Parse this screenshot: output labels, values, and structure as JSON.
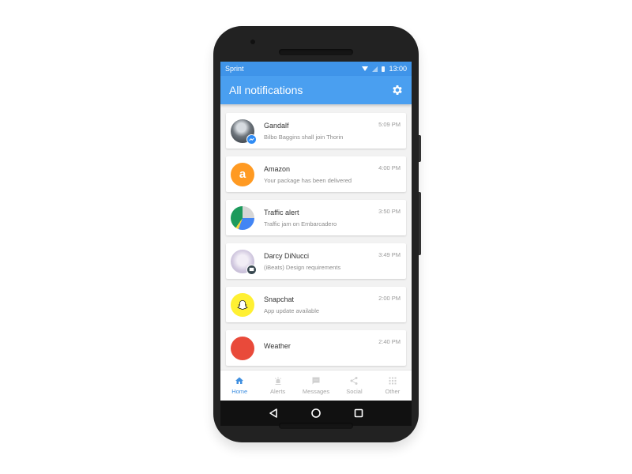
{
  "statusbar": {
    "carrier": "Sprint",
    "time": "13:00",
    "icons": [
      "wifi-icon",
      "signal-icon",
      "battery-icon"
    ]
  },
  "appbar": {
    "title": "All notifications",
    "settings_icon": "gear-icon"
  },
  "notifications": [
    {
      "name": "Gandalf",
      "message": "Bilbo Baggins shall join Thorin",
      "time": "5:09 PM",
      "avatar": "gandalf-photo",
      "badge": "messenger-icon"
    },
    {
      "name": "Amazon",
      "message": "Your package has been delivered",
      "time": "4:00 PM",
      "avatar": "amazon-logo",
      "avatar_glyph": "a"
    },
    {
      "name": "Traffic alert",
      "message": "Traffic jam on Embarcadero",
      "time": "3:50 PM",
      "avatar": "maps-icon"
    },
    {
      "name": "Darcy DiNucci",
      "message": "(iBeats) Design requirements",
      "time": "3:49 PM",
      "avatar": "darcy-photo",
      "badge": "mail-icon"
    },
    {
      "name": "Snapchat",
      "message": "App update available",
      "time": "2:00 PM",
      "avatar": "snapchat-logo"
    },
    {
      "name": "Weather",
      "message": "",
      "time": "2:40 PM",
      "avatar": "weather-icon"
    }
  ],
  "bottom_nav": [
    {
      "label": "Home",
      "icon": "home-icon",
      "active": true
    },
    {
      "label": "Alerts",
      "icon": "alarm-icon",
      "active": false
    },
    {
      "label": "Messages",
      "icon": "message-icon",
      "active": false
    },
    {
      "label": "Social",
      "icon": "share-icon",
      "active": false
    },
    {
      "label": "Other",
      "icon": "apps-grid-icon",
      "active": false
    }
  ],
  "system_nav": [
    "back-icon",
    "home-circle-icon",
    "recents-icon"
  ],
  "colors": {
    "statusbar": "#3f94e9",
    "appbar": "#4a9ff0",
    "active_nav": "#3f8fe0"
  }
}
